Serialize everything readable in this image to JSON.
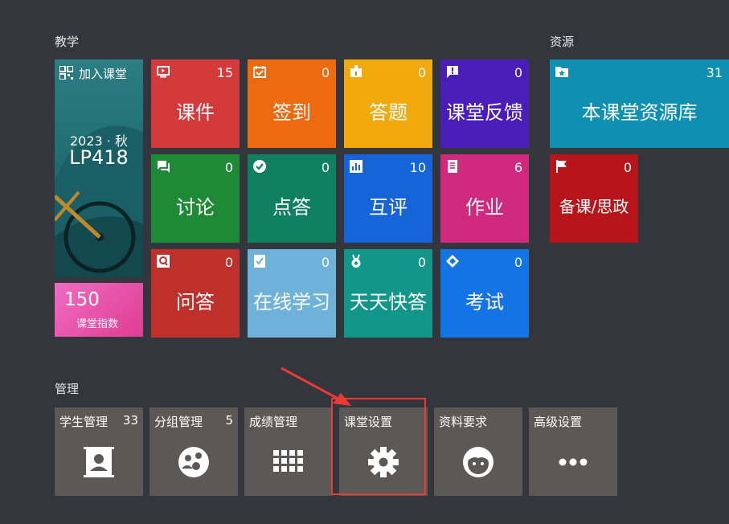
{
  "sections": {
    "teaching": "教学",
    "resources": "资源",
    "management": "管理"
  },
  "class_card": {
    "join": "加入课堂",
    "term": "2023 · 秋",
    "code": "LP418"
  },
  "index_card": {
    "value": "150",
    "label": "课堂指数"
  },
  "teaching_tiles": [
    {
      "label": "课件",
      "count": "15",
      "icon": "screen-icon",
      "color": "#d53a3a"
    },
    {
      "label": "签到",
      "count": "0",
      "icon": "calendar-check-icon",
      "color": "#ee6a0f"
    },
    {
      "label": "答题",
      "count": "0",
      "icon": "quiz-icon",
      "color": "#f0aa0c"
    },
    {
      "label": "课堂反馈",
      "count": "0",
      "icon": "feedback-icon",
      "color": "#4a1db8"
    },
    {
      "label": "讨论",
      "count": "0",
      "icon": "chat-icon",
      "color": "#1f8a35"
    },
    {
      "label": "点答",
      "count": "0",
      "icon": "check-circle-icon",
      "color": "#0f8062"
    },
    {
      "label": "互评",
      "count": "10",
      "icon": "bar-chart-icon",
      "color": "#1565d8"
    },
    {
      "label": "作业",
      "count": "6",
      "icon": "book-icon",
      "color": "#d02a7e"
    },
    {
      "label": "问答",
      "count": "0",
      "icon": "qa-icon",
      "color": "#c0302b"
    },
    {
      "label": "在线学习",
      "count": "0",
      "icon": "study-icon",
      "color": "#6fb2d9"
    },
    {
      "label": "天天快答",
      "count": "0",
      "icon": "medal-icon",
      "color": "#12968a"
    },
    {
      "label": "考试",
      "count": "0",
      "icon": "exam-icon",
      "color": "#1474e5"
    }
  ],
  "resource_tiles": [
    {
      "label": "本课堂资源库",
      "count": "31",
      "icon": "folder-star-icon",
      "color": "#0f90b2"
    },
    {
      "label": "备课/思政",
      "count": "0",
      "icon": "flag-icon",
      "color": "#b8151a"
    }
  ],
  "management_tiles": [
    {
      "label": "学生管理",
      "count": "33",
      "icon": "contact-book-icon"
    },
    {
      "label": "分组管理",
      "count": "5",
      "icon": "group-icon"
    },
    {
      "label": "成绩管理",
      "count": "",
      "icon": "grid-icon"
    },
    {
      "label": "课堂设置",
      "count": "",
      "icon": "gear-icon"
    },
    {
      "label": "资料要求",
      "count": "",
      "icon": "face-icon"
    },
    {
      "label": "高级设置",
      "count": "",
      "icon": "more-icon"
    }
  ],
  "annotation": {
    "color": "#e83b35"
  }
}
